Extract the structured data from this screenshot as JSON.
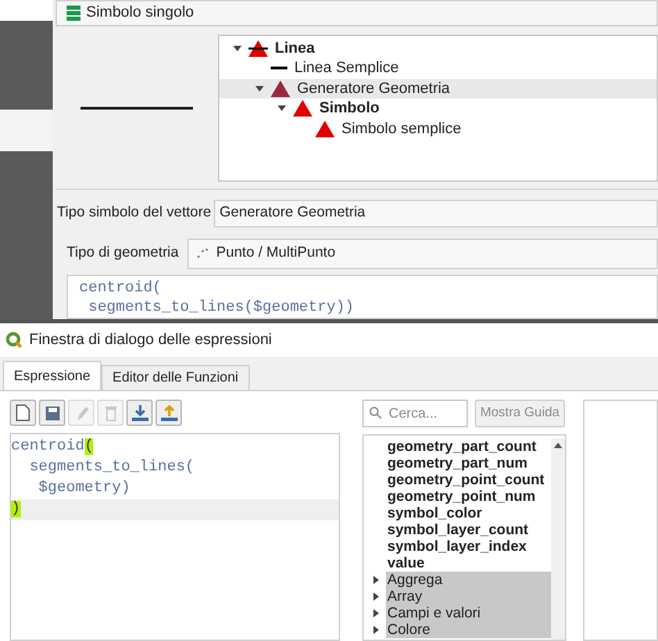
{
  "renderer": {
    "label": "Simbolo singolo"
  },
  "symbol_tree": [
    {
      "label": "Linea",
      "kind": "line-symbol",
      "selected": false,
      "expanded": true,
      "children": [
        {
          "label": "Linea Semplice",
          "kind": "line-layer",
          "selected": false
        },
        {
          "label": "Generatore Geometria",
          "kind": "generator-layer",
          "selected": true,
          "expanded": true,
          "children": [
            {
              "label": "Simbolo",
              "kind": "marker-symbol",
              "selected": false,
              "expanded": true,
              "children": [
                {
                  "label": "Simbolo semplice",
                  "kind": "marker-layer",
                  "selected": false
                }
              ]
            }
          ]
        }
      ]
    }
  ],
  "symbol_layer_type": {
    "label": "Tipo simbolo del vettore",
    "value": "Generatore Geometria"
  },
  "geometry_type": {
    "label": "Tipo di geometria",
    "value": "Punto / MultiPunto"
  },
  "expression_preview": [
    "centroid(",
    " segments_to_lines($geometry))"
  ],
  "dialog": {
    "title": "Finestra di dialogo delle espressioni",
    "tabs": [
      {
        "label": "Espressione",
        "selected": true
      },
      {
        "label": "Editor delle Funzioni",
        "selected": false
      }
    ],
    "toolbar": [
      {
        "kind": "new",
        "disabled": false
      },
      {
        "kind": "save",
        "disabled": false
      },
      {
        "kind": "edit",
        "disabled": true
      },
      {
        "kind": "delete",
        "disabled": true
      },
      {
        "kind": "import",
        "disabled": false
      },
      {
        "kind": "export",
        "disabled": false
      }
    ],
    "editor_lines": [
      {
        "current": false,
        "segments": [
          {
            "text": "centroid",
            "highlight": false
          },
          {
            "text": "(",
            "highlight": true
          }
        ]
      },
      {
        "current": false,
        "segments": [
          {
            "text": "  segments_to_lines(",
            "highlight": false
          }
        ]
      },
      {
        "current": false,
        "segments": [
          {
            "text": "   $geometry)",
            "highlight": false
          }
        ]
      },
      {
        "current": true,
        "segments": [
          {
            "text": ")",
            "highlight": true
          }
        ]
      }
    ],
    "search": {
      "placeholder": "Cerca..."
    },
    "help_button": {
      "label": "Mostra Guida",
      "disabled": true
    },
    "function_list": [
      {
        "label": "geometry_part_count",
        "kind": "variable"
      },
      {
        "label": "geometry_part_num",
        "kind": "variable"
      },
      {
        "label": "geometry_point_count",
        "kind": "variable"
      },
      {
        "label": "geometry_point_num",
        "kind": "variable"
      },
      {
        "label": "symbol_color",
        "kind": "variable"
      },
      {
        "label": "symbol_layer_count",
        "kind": "variable"
      },
      {
        "label": "symbol_layer_index",
        "kind": "variable"
      },
      {
        "label": "value",
        "kind": "variable"
      },
      {
        "label": "Aggrega",
        "kind": "group",
        "expanded": false
      },
      {
        "label": "Array",
        "kind": "group",
        "expanded": false
      },
      {
        "label": "Campi e valori",
        "kind": "group",
        "expanded": false
      },
      {
        "label": "Colore",
        "kind": "group",
        "expanded": false
      }
    ]
  }
}
